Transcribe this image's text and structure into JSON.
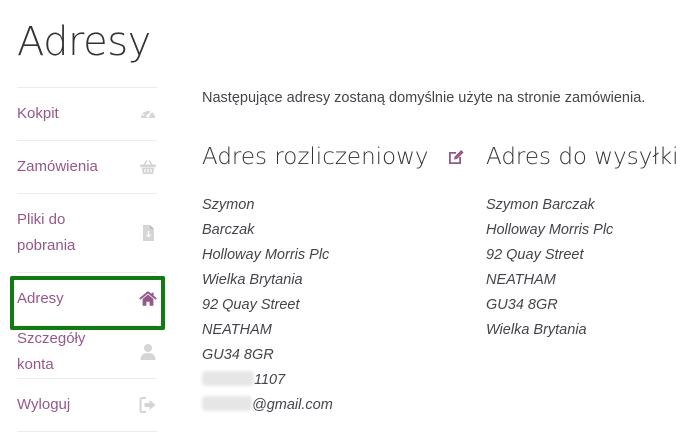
{
  "page": {
    "title": "Adresy"
  },
  "nav": {
    "items": [
      {
        "label": "Kokpit",
        "icon": "dashboard-icon"
      },
      {
        "label": "Zamówienia",
        "icon": "basket-icon"
      },
      {
        "label": "Pliki do pobrania",
        "icon": "file-download-icon"
      },
      {
        "label": "Adresy",
        "icon": "home-icon",
        "active": true
      },
      {
        "label": "Szczegóły konta",
        "icon": "user-icon"
      },
      {
        "label": "Wyloguj",
        "icon": "sign-out-icon"
      }
    ]
  },
  "main": {
    "intro": "Następujące adresy zostaną domyślnie użyte na stronie zamówienia.",
    "billing": {
      "title": "Adres rozliczeniowy",
      "edit_icon": "edit-icon",
      "lines": [
        "Szymon",
        "Barczak",
        "Holloway Morris Plc",
        "Wielka Brytania",
        "92 Quay Street",
        "NEATHAM",
        "GU34 8GR"
      ],
      "phone_visible": "1107",
      "email_visible": "@gmail.com"
    },
    "shipping": {
      "title": "Adres do wysyłki",
      "lines": [
        "Szymon Barczak",
        "Holloway Morris Plc",
        "92 Quay Street",
        "NEATHAM",
        "GU34 8GR",
        "Wielka Brytania"
      ]
    }
  },
  "colors": {
    "accent": "#96588a",
    "icon_gray": "#d5d5d5",
    "highlight_border": "#137a13",
    "text": "#43454b"
  }
}
